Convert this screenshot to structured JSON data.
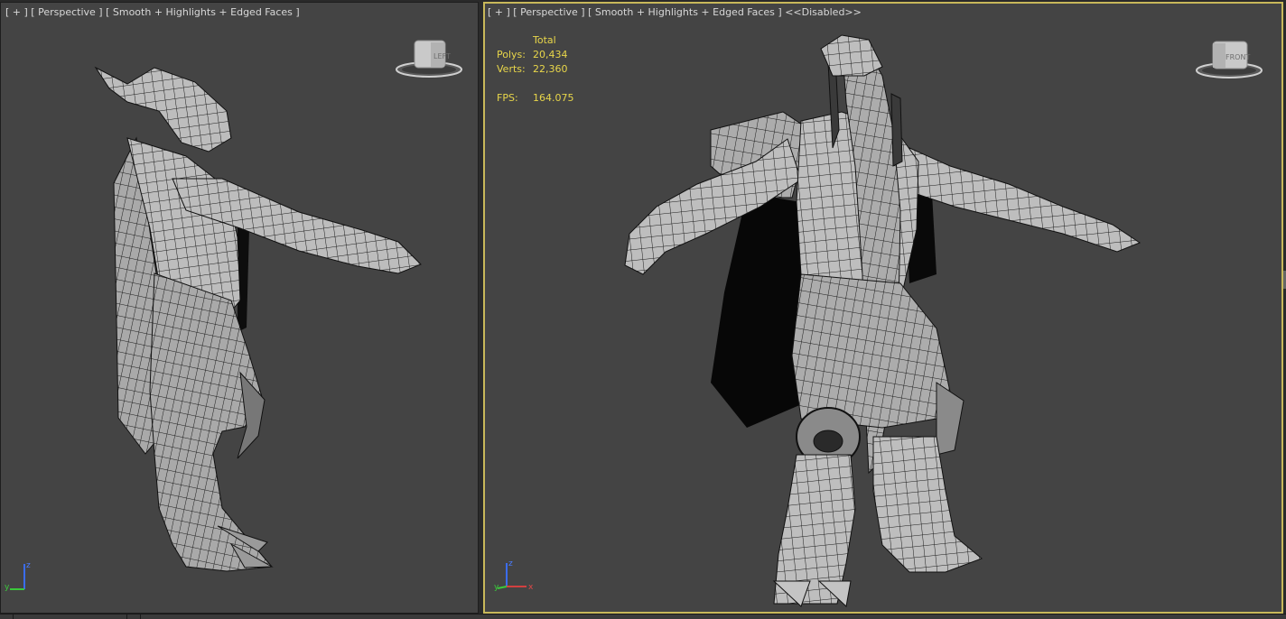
{
  "viewports": {
    "left": {
      "label_parts": [
        "[ + ]",
        "[ Perspective ]",
        "[ Smooth + Highlights + Edged Faces ]"
      ],
      "viewcube_face": "LEFT",
      "axis_labels": {
        "z": "z",
        "y": "y"
      }
    },
    "right": {
      "label_parts": [
        "[ + ]",
        "[ Perspective ]",
        "[ Smooth + Highlights + Edged Faces ]",
        "<<Disabled>>"
      ],
      "viewcube_face": "FRONT",
      "axis_labels": {
        "z": "z",
        "y": "y",
        "x": "x"
      },
      "stats": {
        "header": "Total",
        "polys_label": "Polys:",
        "polys_value": "20,434",
        "verts_label": "Verts:",
        "verts_value": "22,360",
        "fps_label": "FPS:",
        "fps_value": "164.075"
      }
    }
  },
  "colors": {
    "viewport_bg": "#444444",
    "active_border": "#c8b85a",
    "stats_text": "#e8d64a",
    "label_text": "#d8d8d8",
    "mesh_fill": "#b9b9b9",
    "mesh_edge": "#1a1a1a"
  },
  "icons": [
    "viewcube-icon",
    "axis-tripod-icon",
    "wireframe-model"
  ]
}
